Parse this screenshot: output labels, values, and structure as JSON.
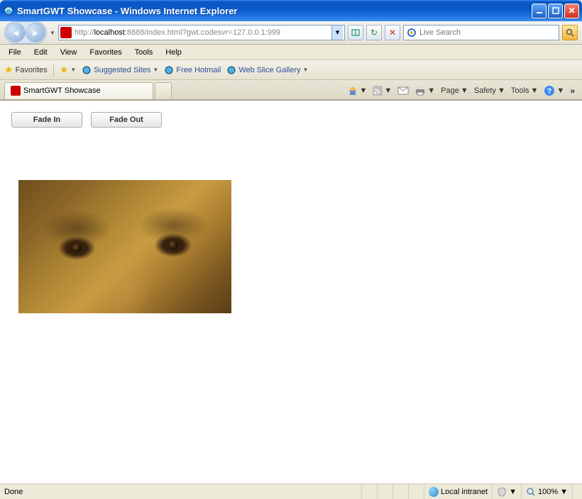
{
  "window": {
    "title": "SmartGWT Showcase - Windows Internet Explorer"
  },
  "addressbar": {
    "url_prefix": "http://",
    "url_host": "localhost",
    "url_rest": ":8888/index.html?gwt.codesvr=127.0.0.1:999"
  },
  "search": {
    "placeholder": "Live Search"
  },
  "menu": {
    "file": "File",
    "edit": "Edit",
    "view": "View",
    "favorites": "Favorites",
    "tools": "Tools",
    "help": "Help"
  },
  "favbar": {
    "favorites": "Favorites",
    "suggested": "Suggested Sites",
    "hotmail": "Free Hotmail",
    "webslice": "Web Slice Gallery"
  },
  "tab": {
    "title": "SmartGWT Showcase"
  },
  "tabtools": {
    "page": "Page",
    "safety": "Safety",
    "tools": "Tools"
  },
  "app": {
    "fade_in": "Fade In",
    "fade_out": "Fade Out"
  },
  "status": {
    "done": "Done",
    "zone": "Local intranet",
    "zoom": "100%"
  }
}
